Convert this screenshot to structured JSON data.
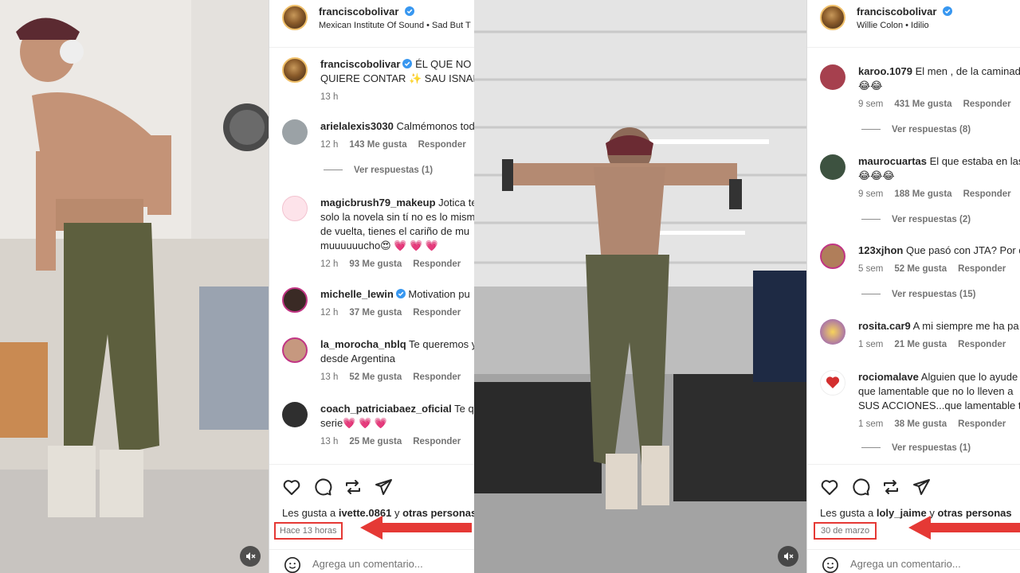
{
  "colors": {
    "accent_red": "#e53935",
    "blue_verified": "#3897f0",
    "muted": "#737373"
  },
  "left_post": {
    "username": "franciscobolivar",
    "audio": "Mexican Institute Of Sound • Sad But T",
    "caption_user": "franciscobolivar",
    "caption_line1": "ÉL QUE NO S",
    "caption_line2": "QUIERE CONTAR ✨ SAU ISNAH",
    "caption_time": "13 h",
    "comments": [
      {
        "user": "arielalexis3030",
        "lines": [
          "Calmémonos tod"
        ],
        "time": "12 h",
        "likes": "143 Me gusta",
        "reply": "Responder",
        "replies": "Ver respuestas (1)"
      },
      {
        "user": "magicbrush79_makeup",
        "lines": [
          "Jotica te",
          "solo la novela sin tí no es lo mism",
          "de vuelta, tienes el cariño de mu",
          "muuuuuucho😍 💗 💗 💗"
        ],
        "time": "12 h",
        "likes": "93 Me gusta",
        "reply": "Responder"
      },
      {
        "user": "michelle_lewin",
        "lines": [
          "Motivation pu"
        ],
        "time": "12 h",
        "likes": "37 Me gusta",
        "reply": "Responder"
      },
      {
        "user": "la_morocha_nblq",
        "lines": [
          "Te queremos y",
          "desde Argentina"
        ],
        "time": "13 h",
        "likes": "52 Me gusta",
        "reply": "Responder"
      },
      {
        "user": "coach_patriciabaez_oficial",
        "lines": [
          "Te qu",
          "serie💗 💗 💗"
        ],
        "time": "13 h",
        "likes": "25 Me gusta",
        "reply": "Responder"
      }
    ],
    "liked_by_prefix": "Les gusta a ",
    "liked_by_user": "ivette.0861",
    "liked_by_suffix": " y ",
    "liked_by_others": "otras personas",
    "date": "Hace 13 horas",
    "add_comment_placeholder": "Agrega un comentario..."
  },
  "right_post": {
    "username": "franciscobolivar",
    "audio": "Willie Colon • Idilio",
    "comments": [
      {
        "user": "karoo.1079",
        "lines": [
          "El men , de la caminad",
          "😂😂"
        ],
        "time": "9 sem",
        "likes": "431 Me gusta",
        "reply": "Responder",
        "replies": "Ver respuestas (8)"
      },
      {
        "user": "maurocuartas",
        "lines": [
          "El que estaba en las",
          "😂😂😂"
        ],
        "time": "9 sem",
        "likes": "188 Me gusta",
        "reply": "Responder",
        "replies": "Ver respuestas (2)"
      },
      {
        "user": "123xjhon",
        "lines": [
          "Que pasó con JTA? Por q"
        ],
        "time": "5 sem",
        "likes": "52 Me gusta",
        "reply": "Responder",
        "replies": "Ver respuestas (15)"
      },
      {
        "user": "rosita.car9",
        "lines": [
          "A mi siempre me ha pa"
        ],
        "time": "1 sem",
        "likes": "21 Me gusta",
        "reply": "Responder"
      },
      {
        "user": "rociomalave",
        "lines": [
          "Alguien que lo ayude",
          "que lamentable que no lo lleven a",
          "SUS ACCIONES...que lamentable ta"
        ],
        "time": "1 sem",
        "likes": "38 Me gusta",
        "reply": "Responder",
        "replies": "Ver respuestas (1)"
      }
    ],
    "liked_by_prefix": "Les gusta a ",
    "liked_by_user": "loly_jaime",
    "liked_by_suffix": " y ",
    "liked_by_others": "otras personas",
    "date": "30 de marzo",
    "add_comment_placeholder": "Agrega un comentario..."
  }
}
